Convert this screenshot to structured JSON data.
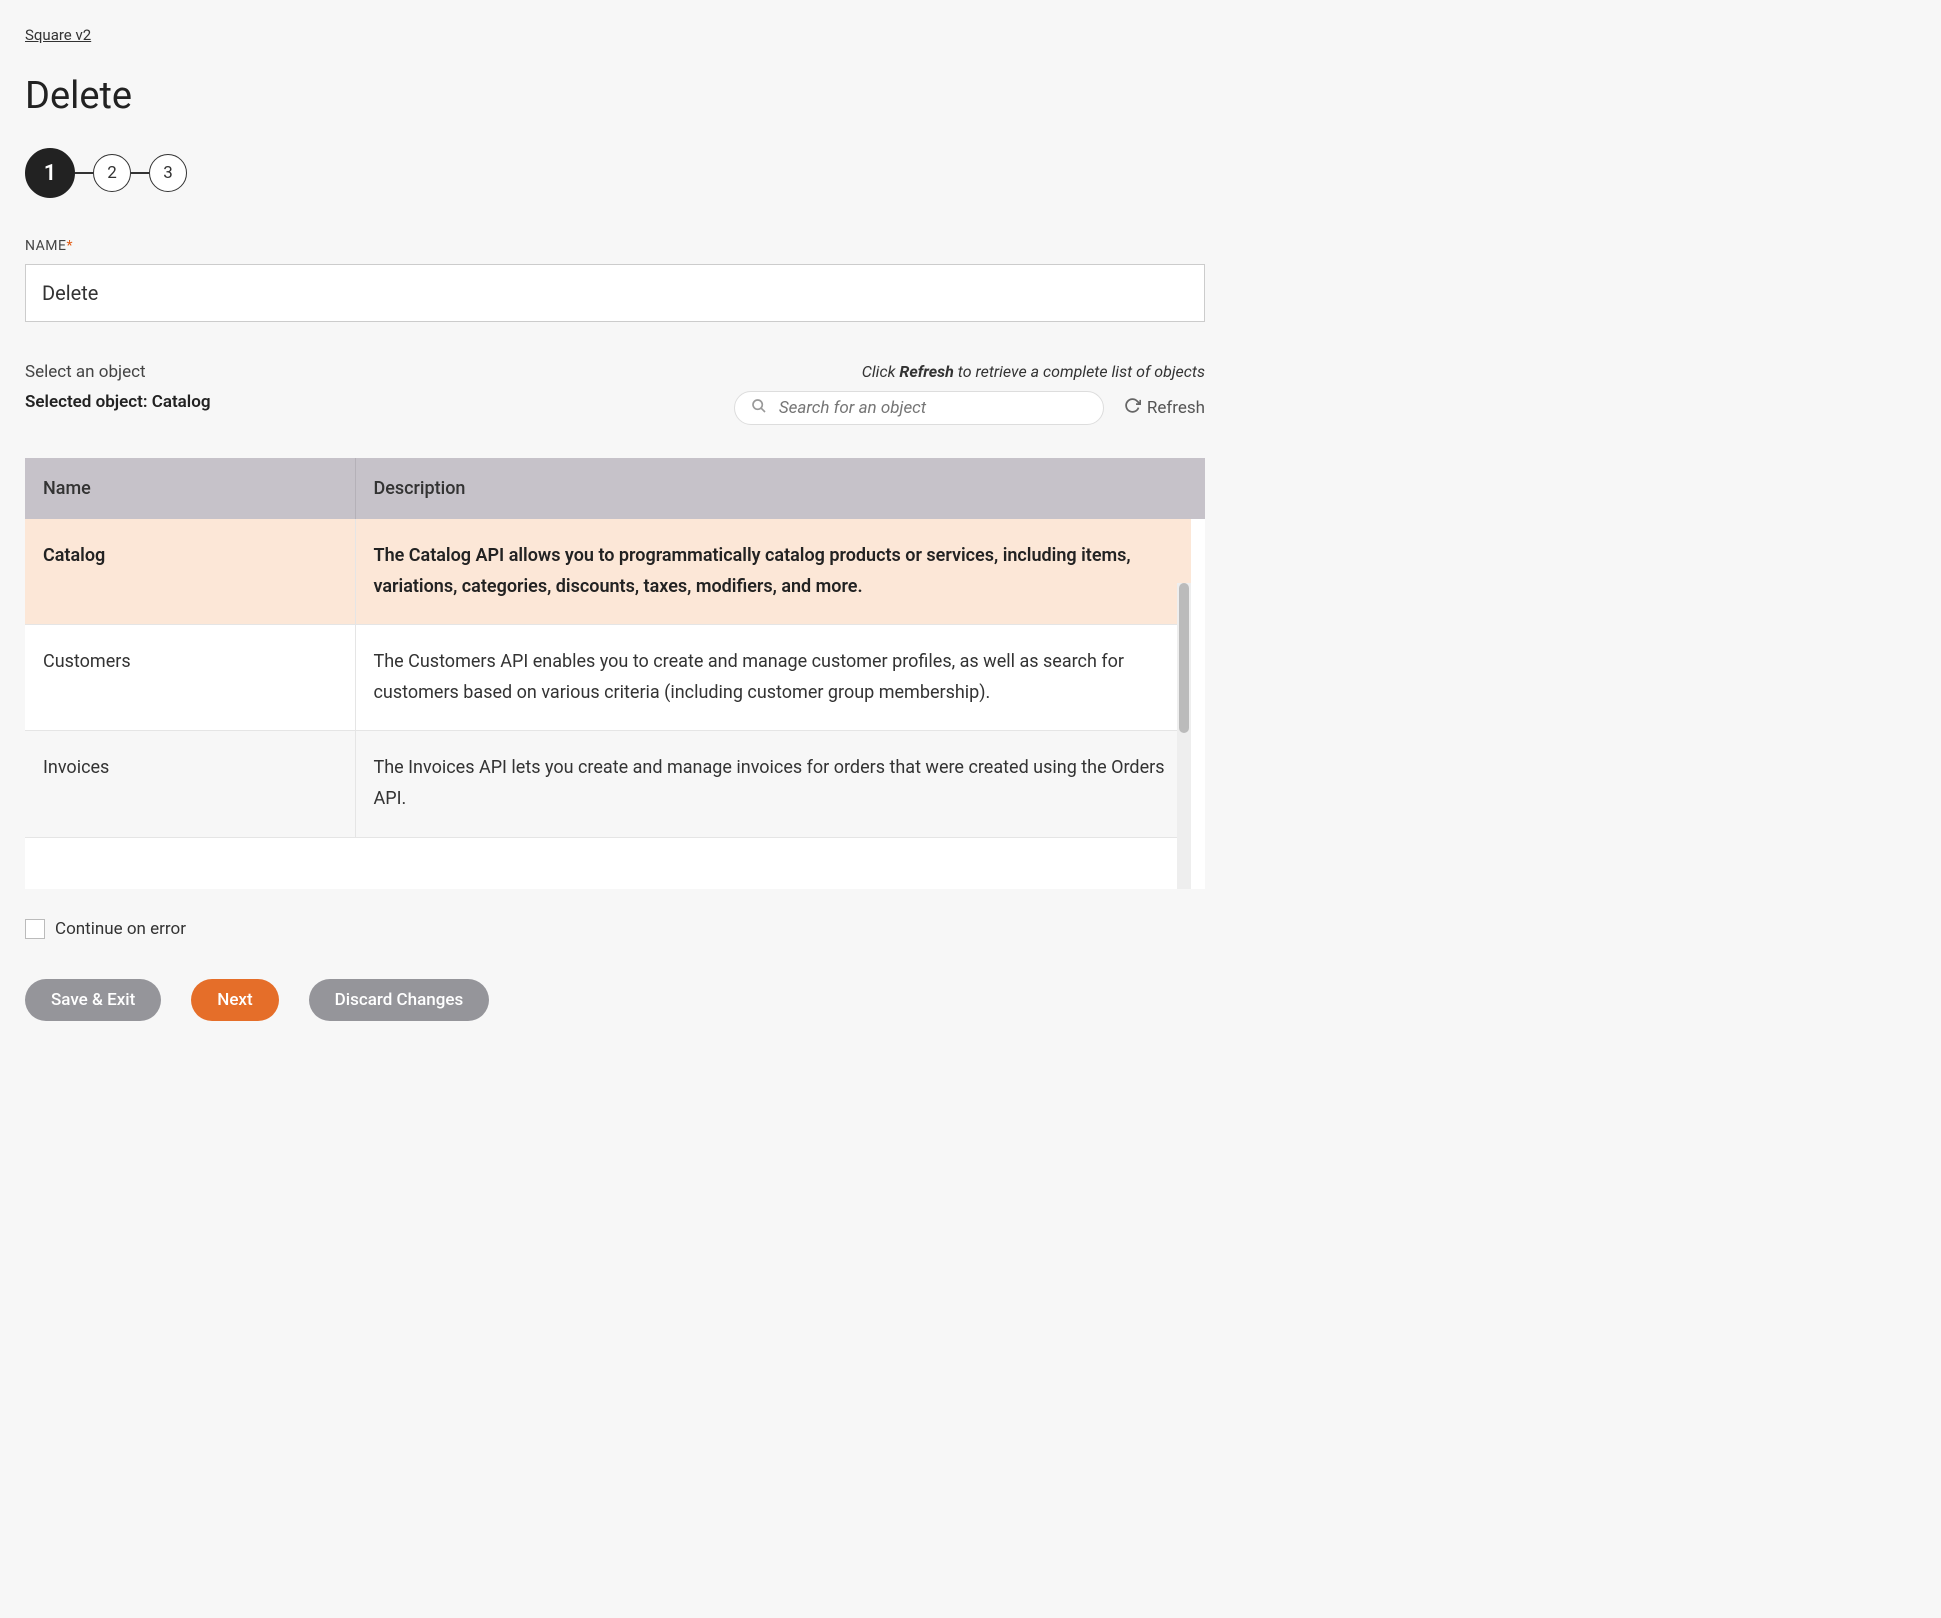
{
  "breadcrumb": "Square v2",
  "page_title": "Delete",
  "stepper": {
    "steps": [
      "1",
      "2",
      "3"
    ],
    "active_index": 0
  },
  "name_field": {
    "label": "NAME",
    "required_marker": "*",
    "value": "Delete"
  },
  "object_section": {
    "select_label": "Select an object",
    "selected_prefix": "Selected object: ",
    "selected_value": "Catalog",
    "refresh_hint_pre": "Click ",
    "refresh_hint_bold": "Refresh",
    "refresh_hint_post": " to retrieve a complete list of objects",
    "search_placeholder": "Search for an object",
    "refresh_label": "Refresh"
  },
  "table": {
    "headers": [
      "Name",
      "Description"
    ],
    "rows": [
      {
        "name": "Catalog",
        "description": "The Catalog API allows you to programmatically catalog products or services, including items, variations, categories, discounts, taxes, modifiers, and more.",
        "selected": true
      },
      {
        "name": "Customers",
        "description": "The Customers API enables you to create and manage customer profiles, as well as search for customers based on various criteria (including customer group membership).",
        "selected": false
      },
      {
        "name": "Invoices",
        "description": "The Invoices API lets you create and manage invoices for orders that were created using the Orders API.",
        "selected": false
      }
    ]
  },
  "continue_on_error": {
    "label": "Continue on error",
    "checked": false
  },
  "buttons": {
    "save_exit": "Save & Exit",
    "next": "Next",
    "discard": "Discard Changes"
  }
}
